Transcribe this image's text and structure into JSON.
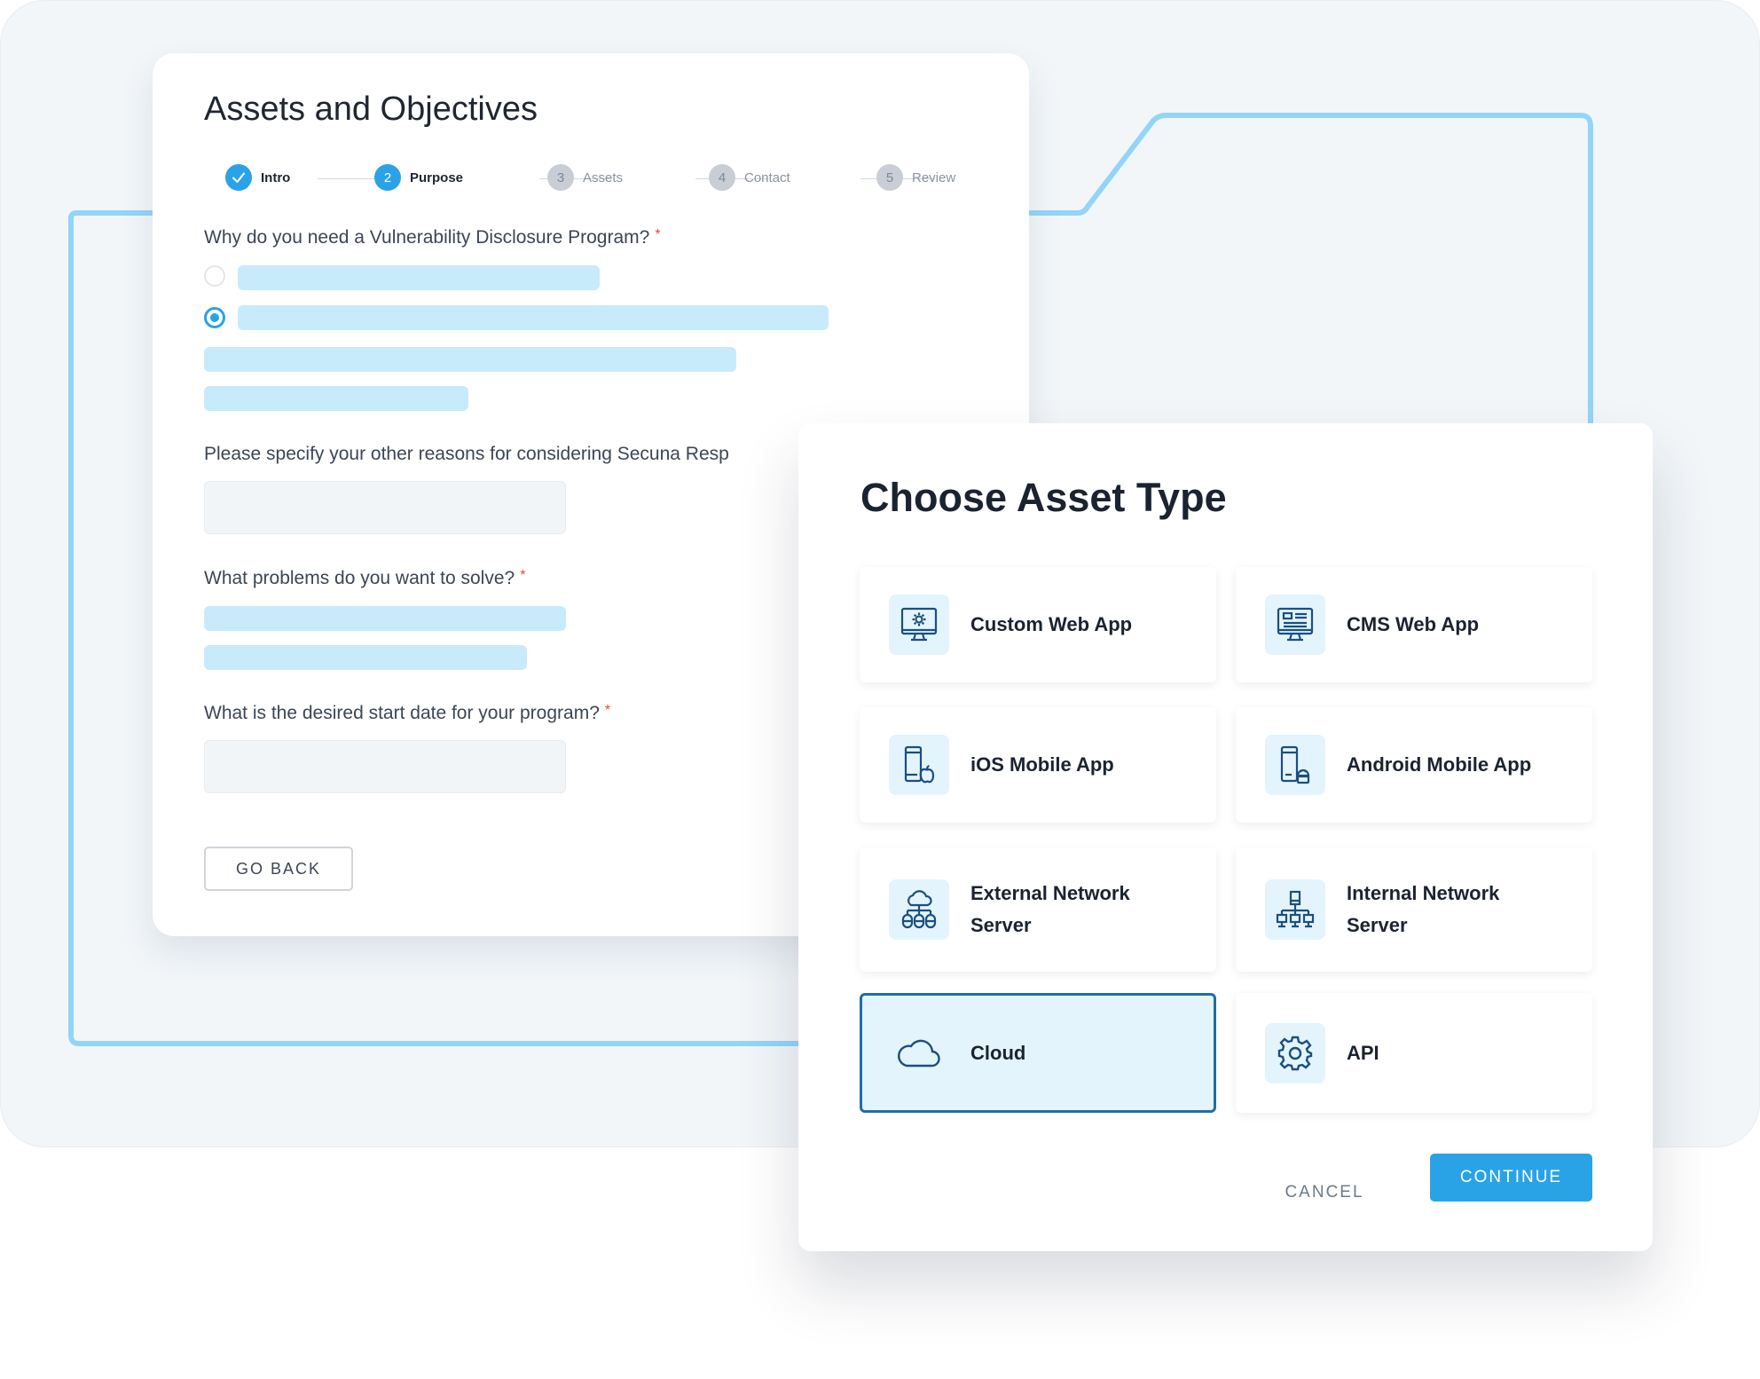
{
  "form": {
    "title": "Assets and Objectives",
    "steps": [
      {
        "number": "1",
        "label": "Intro",
        "state": "complete"
      },
      {
        "number": "2",
        "label": "Purpose",
        "state": "active"
      },
      {
        "number": "3",
        "label": "Assets",
        "state": "upcoming"
      },
      {
        "number": "4",
        "label": "Contact",
        "state": "upcoming"
      },
      {
        "number": "5",
        "label": "Review",
        "state": "upcoming"
      }
    ],
    "questions": {
      "why_vdp": "Why do you need a Vulnerability Disclosure Program?",
      "other_reasons": "Please specify your other reasons for considering Secuna Resp",
      "problems": "What problems do you want to solve?",
      "start_date": "What is the desired start date for your program?"
    },
    "required_marker": "*",
    "radio_options": [
      {
        "selected": false
      },
      {
        "selected": true
      }
    ],
    "other_reasons_value": "",
    "start_date_value": "",
    "go_back_label": "GO BACK"
  },
  "modal": {
    "title": "Choose Asset Type",
    "asset_types": [
      {
        "label": "Custom Web App",
        "icon": "monitor-gear-icon",
        "selected": false
      },
      {
        "label": "CMS Web App",
        "icon": "monitor-layout-icon",
        "selected": false
      },
      {
        "label": "iOS Mobile App",
        "icon": "phone-apple-icon",
        "selected": false
      },
      {
        "label": "Android Mobile App",
        "icon": "phone-android-icon",
        "selected": false
      },
      {
        "label": "External Network Server",
        "line1": "External Network",
        "line2": "Server",
        "icon": "cloud-network-icon",
        "selected": false
      },
      {
        "label": "Internal Network Server",
        "line1": "Internal Network",
        "line2": "Server",
        "icon": "server-network-icon",
        "selected": false
      },
      {
        "label": "Cloud",
        "icon": "cloud-icon",
        "selected": true
      },
      {
        "label": "API",
        "icon": "gear-icon",
        "selected": false
      }
    ],
    "cancel_label": "CANCEL",
    "continue_label": "CONTINUE"
  },
  "colors": {
    "accent": "#29a3e6",
    "selected_border": "#1f6ea5",
    "placeholder_bar": "#c8ebfc",
    "decor_line": "#93d5f8",
    "required": "#e0483c"
  }
}
